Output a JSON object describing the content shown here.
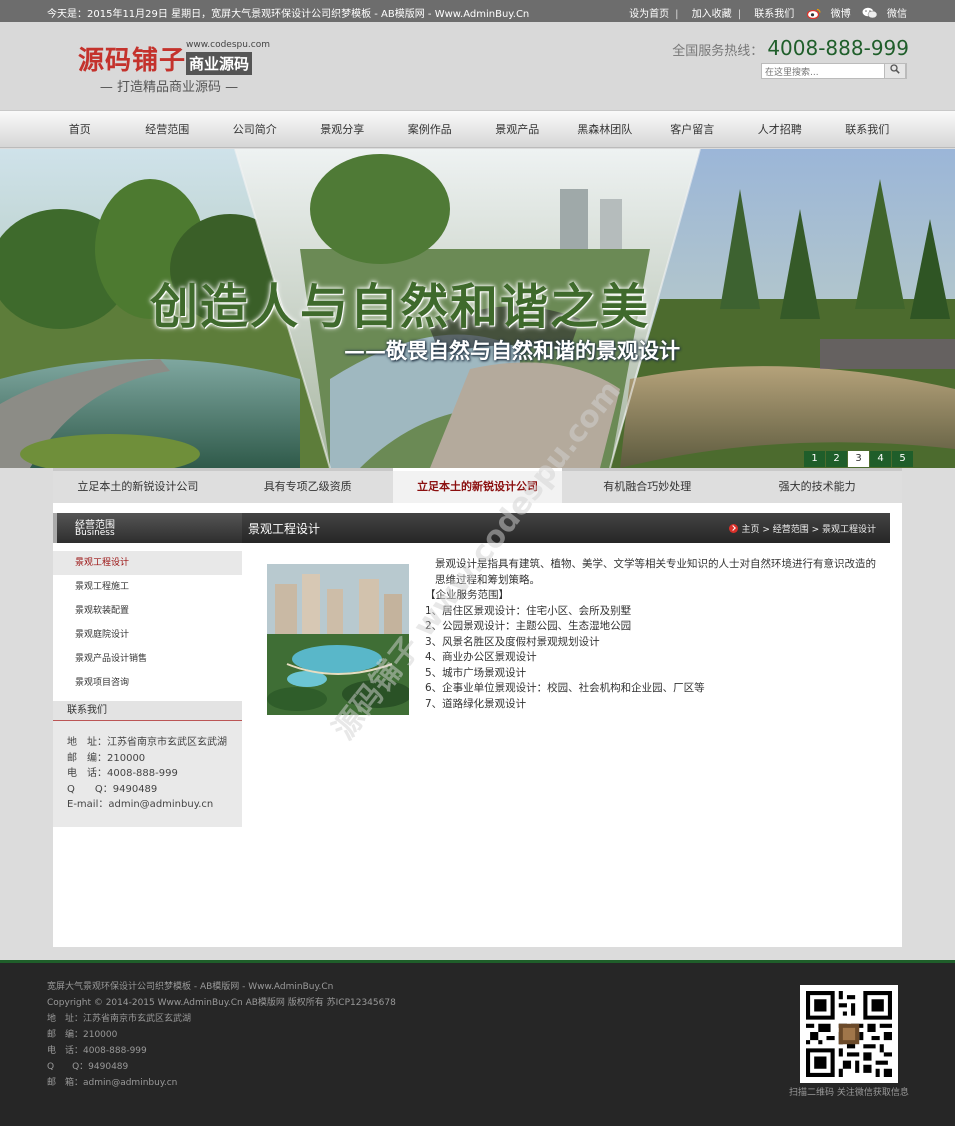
{
  "topbar": {
    "date_text": "今天是：2015年11月29日 星期日，宽屏大气景观环保设计公司织梦模板 - AB模版网 - Www.AdminBuy.Cn",
    "links": [
      "设为首页",
      "加入收藏",
      "联系我们"
    ],
    "weibo": "微博",
    "weixin": "微信"
  },
  "logo": {
    "main": "源码铺子",
    "domain": "www.codespu.com",
    "badge": "商业源码",
    "slogan": "— 打造精品商业源码 —"
  },
  "header": {
    "hotline_label": "全国服务热线：",
    "hotline_number": "4008-888-999",
    "search_placeholder": "在这里搜索...",
    "search_icon": "search-icon"
  },
  "nav": [
    "首页",
    "经营范围",
    "公司简介",
    "景观分享",
    "案例作品",
    "景观产品",
    "黑森林团队",
    "客户留言",
    "人才招聘",
    "联系我们"
  ],
  "banner": {
    "headline": "创造人与自然和谐之美",
    "subline": "——敬畏自然与自然和谐的景观设计",
    "pager": [
      "1",
      "2",
      "3",
      "4",
      "5"
    ],
    "active_page": "3"
  },
  "tabs": [
    "立足本土的新锐设计公司",
    "具有专项乙级资质",
    "立足本土的新锐设计公司",
    "有机融合巧妙处理",
    "强大的技术能力"
  ],
  "sidebar": {
    "title_zh": "经营范围",
    "title_en": "Business",
    "items": [
      "景观工程设计",
      "景观工程施工",
      "景观软装配置",
      "景观庭院设计",
      "景观产品设计销售",
      "景观项目咨询"
    ],
    "contact": {
      "title": "联系我们",
      "lines": [
        "地　址：江苏省南京市玄武区玄武湖",
        "邮　编：210000",
        "电　话：4008-888-999",
        "Q　　Q：9490489",
        "E-mail：admin@adminbuy.cn"
      ]
    }
  },
  "main": {
    "title": "景观工程设计",
    "breadcrumb": "主页 > 经营范围 > 景观工程设计",
    "intro": "景观设计是指具有建筑、植物、美学、文学等相关专业知识的人士对自然环境进行有意识改造的思维过程和筹划策略。",
    "section_title": "【企业服务范围】",
    "list": [
      "1、居住区景观设计：住宅小区、会所及别墅",
      "2、公园景观设计：主题公园、生态湿地公园",
      "3、风景名胜区及度假村景观规划设计",
      "4、商业办公区景观设计",
      "5、城市广场景观设计",
      "6、企事业单位景观设计：校园、社会机构和企业园、厂区等",
      "7、道路绿化景观设计"
    ]
  },
  "watermark": "源码铺子 www.codespu.com",
  "footer": {
    "lines": [
      "宽屏大气景观环保设计公司织梦模板 - AB模版网 - Www.AdminBuy.Cn",
      "Copyright © 2014-2015 Www.AdminBuy.Cn AB模版网 版权所有  苏ICP12345678",
      "地　址：江苏省南京市玄武区玄武湖",
      "邮　编：210000",
      "电　话：4008-888-999",
      "Q　　Q：9490489",
      "邮　箱：admin@adminbuy.cn"
    ],
    "qr_caption": "扫描二维码 关注微信获取信息"
  },
  "colors": {
    "brand_green": "#1f5e2a",
    "accent_red": "#9a1010",
    "logo_red": "#c4322c"
  }
}
